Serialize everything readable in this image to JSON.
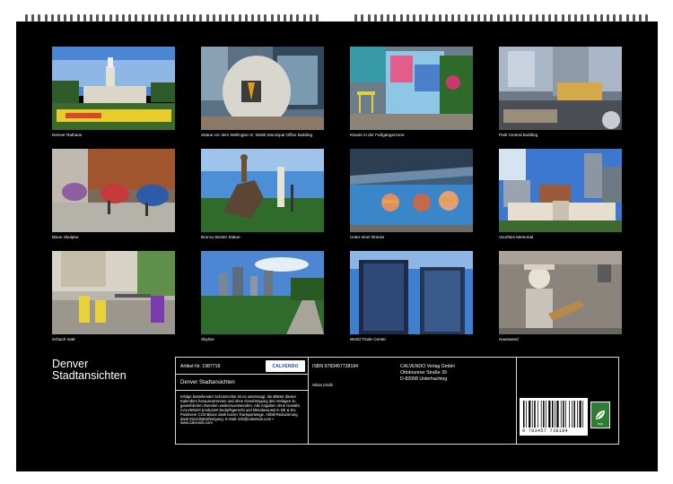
{
  "cover": {
    "title_line1": "Denver",
    "title_line2": "Stadtansichten"
  },
  "photos": [
    {
      "caption": "Denver Rathaus"
    },
    {
      "caption": "Statue vor dem Wellington E. Webb Municipal Office Building"
    },
    {
      "caption": "Klavier in der Fußgängerzone"
    },
    {
      "caption": "Park Central Building"
    },
    {
      "caption": "Bison Skulptur"
    },
    {
      "caption": "Bronco Buster Statue"
    },
    {
      "caption": "Unter einer Brücke"
    },
    {
      "caption": "Voorhies Memorial"
    },
    {
      "caption": "Schach matt"
    },
    {
      "caption": "Skyline"
    },
    {
      "caption": "World Trade Center"
    },
    {
      "caption": "Hauswand"
    }
  ],
  "info": {
    "article": "Artikel-Nr. 1987718",
    "logo_text": "CALVENDO",
    "product_title": "Denver Stadtansichten",
    "isbn": "ISBN 9783457738184",
    "author": "Silvia Drafz",
    "publisher_line1": "CALVENDO Verlag GmbH",
    "publisher_line2": "Ottobrunner Straße 39",
    "publisher_line3": "D-82008 Unterhaching",
    "legal": "Infolge bestehender Schutzrechte ist es unterssagt, die Blätter dieses Kalenders herauszutrennen und ohne Genehmigung des Verlages zu gewerblichen Zwecken weiterzuverwenden. Alle Angaben ohne Gewähr. CALVENDO produziert bedarfsgerecht und klimabewusst in DE & EU. Positivere CO2-Bilanz dank kurzer Transportwege. Abfall-Reduzierung dank Einzelstückfertigung. E-Mail: info@calvendo.com • www.calvendo.com",
    "barcode_number": "9 783457 738184",
    "eco_label": "eco"
  }
}
